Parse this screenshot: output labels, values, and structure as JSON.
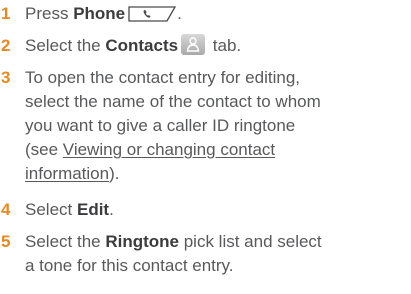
{
  "steps": [
    {
      "number": "1",
      "pre": "Press ",
      "bold": "Phone",
      "post": ".",
      "icon": "phone-key-icon"
    },
    {
      "number": "2",
      "pre": "Select the ",
      "bold": "Contacts",
      "post": "tab.",
      "icon": "contacts-tab-icon"
    },
    {
      "number": "3",
      "line1": "To open the contact entry for editing,",
      "line2": "select the name of the contact to whom",
      "line3": "you want to give a caller ID ringtone",
      "line4_pre": "(see ",
      "link_part1": "Viewing or changing contact",
      "link_part2": "information",
      "line5_post": ")."
    },
    {
      "number": "4",
      "pre": "Select ",
      "bold": "Edit",
      "post": "."
    },
    {
      "number": "5",
      "pre": "Select the ",
      "bold": "Ringtone",
      "post": " pick list and select",
      "line2": "a tone for this contact entry."
    }
  ],
  "colors": {
    "step_number": "#e8891f",
    "body_text": "#58595b"
  }
}
